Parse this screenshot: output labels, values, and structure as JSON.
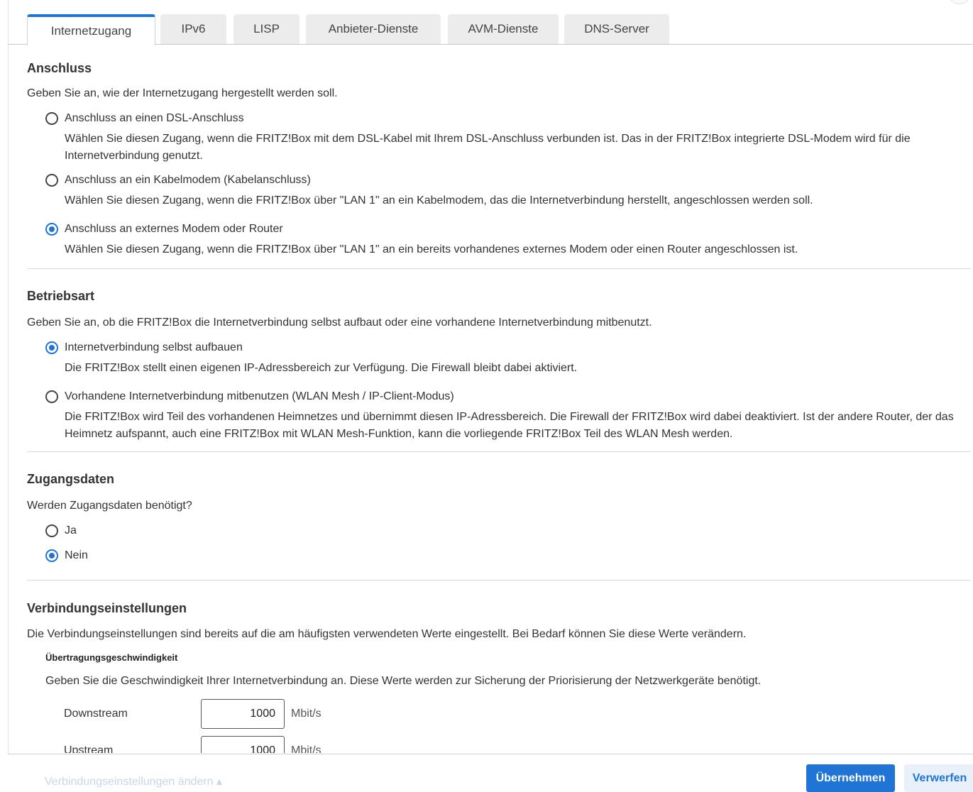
{
  "tabs": [
    {
      "label": "Internetzugang",
      "active": true
    },
    {
      "label": "IPv6"
    },
    {
      "label": "LISP"
    },
    {
      "label": "Anbieter-Dienste"
    },
    {
      "label": "AVM-Dienste"
    },
    {
      "label": "DNS-Server"
    }
  ],
  "anschluss": {
    "title": "Anschluss",
    "description": "Geben Sie an, wie der Internetzugang hergestellt werden soll.",
    "options": [
      {
        "label": "Anschluss an einen DSL-Anschluss",
        "help": "Wählen Sie diesen Zugang, wenn die FRITZ!Box mit dem DSL-Kabel mit Ihrem DSL-Anschluss verbunden ist. Das in der FRITZ!Box integrierte DSL-Modem wird für die Internetverbindung genutzt.",
        "checked": false
      },
      {
        "label": "Anschluss an ein Kabelmodem (Kabelanschluss)",
        "help": "Wählen Sie diesen Zugang, wenn die FRITZ!Box über \"LAN 1\" an ein Kabelmodem, das die Internetverbindung herstellt, angeschlossen werden soll.",
        "checked": false
      },
      {
        "label": "Anschluss an externes Modem oder Router",
        "help": "Wählen Sie diesen Zugang, wenn die FRITZ!Box über \"LAN 1\" an ein bereits vorhandenes externes Modem oder einen Router angeschlossen ist.",
        "checked": true
      }
    ]
  },
  "betriebsart": {
    "title": "Betriebsart",
    "description": "Geben Sie an, ob die FRITZ!Box die Internetverbindung selbst aufbaut oder eine vorhandene Internetverbindung mitbenutzt.",
    "options": [
      {
        "label": "Internetverbindung selbst aufbauen",
        "help": "Die FRITZ!Box stellt einen eigenen IP-Adressbereich zur Verfügung. Die Firewall bleibt dabei aktiviert.",
        "checked": true
      },
      {
        "label": "Vorhandene Internetverbindung mitbenutzen (WLAN Mesh / IP-Client-Modus)",
        "help": "Die FRITZ!Box wird Teil des vorhandenen Heimnetzes und übernimmt diesen IP-Adressbereich. Die Firewall der FRITZ!Box wird dabei deaktiviert. Ist der andere Router, der das Heimnetz aufspannt, auch eine FRITZ!Box mit WLAN Mesh-Funktion, kann die vorliegende FRITZ!Box Teil des WLAN Mesh werden.",
        "checked": false
      }
    ]
  },
  "zugangsdaten": {
    "title": "Zugangsdaten",
    "description": "Werden Zugangsdaten benötigt?",
    "options": [
      {
        "label": "Ja",
        "checked": false
      },
      {
        "label": "Nein",
        "checked": true
      }
    ]
  },
  "verbindung": {
    "title": "Verbindungseinstellungen",
    "description": "Die Verbindungseinstellungen sind bereits auf die am häufigsten verwendeten Werte eingestellt. Bei Bedarf können Sie diese Werte verändern.",
    "subtitle": "Übertragungsgeschwindigkeit",
    "subdescription": "Geben Sie die Geschwindigkeit Ihrer Internetverbindung an. Diese Werte werden zur Sicherung der Priorisierung der Netzwerkgeräte benötigt.",
    "downstream": {
      "label": "Downstream",
      "value": "1000",
      "unit": "Mbit/s"
    },
    "upstream": {
      "label": "Upstream",
      "value": "1000",
      "unit": "Mbit/s"
    }
  },
  "footer": {
    "change_link": "Verbindungseinstellungen ändern ▴",
    "apply_label": "Übernehmen",
    "discard_label": "Verwerfen"
  },
  "colors": {
    "accent": "#1f74d6",
    "text": "#333333",
    "divider": "#d7d7d7"
  }
}
